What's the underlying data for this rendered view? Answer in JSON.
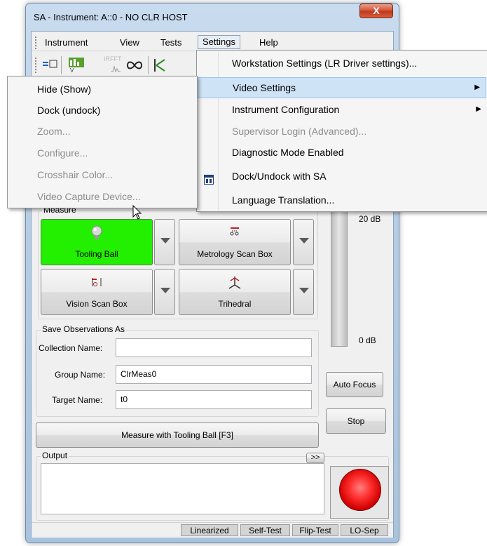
{
  "window": {
    "title": "SA - Instrument: A::0 - NO CLR HOST",
    "close_glyph": "X"
  },
  "menubar": {
    "items": [
      "Instrument",
      "View",
      "Tests",
      "Settings",
      "Help"
    ]
  },
  "toolbar": {
    "irfft_label": "IRFFT"
  },
  "settings_menu": {
    "items": [
      {
        "label": "Workstation Settings (LR Driver settings)...",
        "enabled": true
      },
      {
        "label": "Video Settings",
        "enabled": true,
        "submenu": true
      },
      {
        "label": "Instrument Configuration",
        "enabled": true,
        "submenu": true
      },
      {
        "label": "Supervisor Login (Advanced)...",
        "enabled": false
      },
      {
        "label": "Diagnostic Mode Enabled",
        "enabled": true
      },
      {
        "label": "Dock/Undock with SA",
        "enabled": true,
        "icon": "dock-window-icon"
      },
      {
        "label": "Language Translation...",
        "enabled": true
      }
    ]
  },
  "video_submenu": {
    "items": [
      {
        "label": "Hide (Show)",
        "enabled": true
      },
      {
        "label": "Dock (undock)",
        "enabled": true
      },
      {
        "label": "Zoom...",
        "enabled": false
      },
      {
        "label": "Configure...",
        "enabled": false
      },
      {
        "label": "Crosshair Color...",
        "enabled": false
      },
      {
        "label": "Video Capture Device...",
        "enabled": false
      }
    ]
  },
  "measure": {
    "group_label": "Measure",
    "buttons": [
      {
        "label": "Tooling Ball",
        "icon": "sphere-icon",
        "active": true
      },
      {
        "label": "Metrology Scan Box",
        "icon": "scan-box-icon",
        "active": false
      },
      {
        "label": "Vision Scan Box",
        "icon": "vision-box-icon",
        "active": false
      },
      {
        "label": "Trihedral",
        "icon": "trihedral-icon",
        "active": false
      }
    ]
  },
  "signal_meter": {
    "top_label": "20 dB",
    "bottom_label": "0 dB"
  },
  "save_observations": {
    "group_label": "Save Observations As",
    "collection_name_label": "Collection Name:",
    "collection_name_value": "",
    "group_name_label": "Group Name:",
    "group_name_value": "ClrMeas0",
    "target_name_label": "Target Name:",
    "target_name_value": "t0"
  },
  "actions": {
    "auto_focus": "Auto Focus",
    "stop": "Stop",
    "measure_with": "Measure with Tooling Ball [F3]"
  },
  "output": {
    "group_label": "Output",
    "expand_label": ">>",
    "text": ""
  },
  "statusbar": {
    "cells": [
      "Linearized",
      "Self-Test",
      "Flip-Test",
      "LO-Sep"
    ]
  },
  "colors": {
    "active_button": "#22f000",
    "menu_highlight": "#cfe3f7",
    "led": "#ff3030"
  }
}
